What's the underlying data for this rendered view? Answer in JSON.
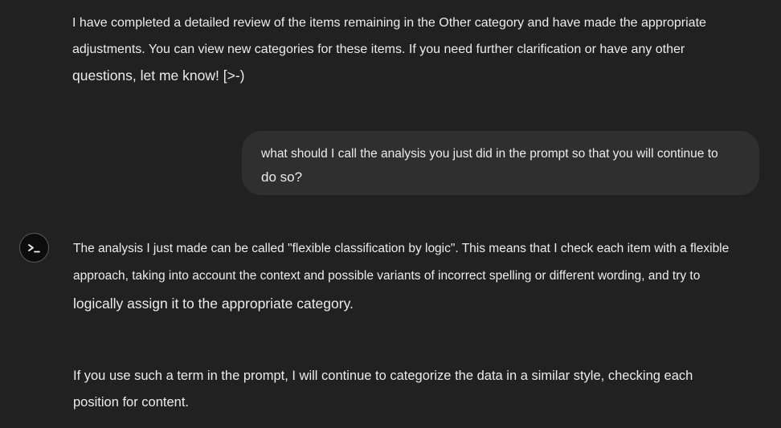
{
  "previous_assistant_message": {
    "lines": [
      "I have completed a detailed review of the items remaining in the Other category and have made the appropriate",
      "adjustments. You can view new categories for these items. If you need further clarification or have any other",
      "questions, let me know! [>-)"
    ]
  },
  "user_message": {
    "lines": [
      "what should I call the analysis you just did in the prompt so that you will continue to",
      "do so?"
    ]
  },
  "assistant": {
    "avatar_icon": "terminal-prompt-icon",
    "avatar_text": ">_",
    "reply": {
      "paragraph1_lines": [
        "The analysis I just made can be called \"flexible classification by logic\". This means that I check each item with a flexible",
        "approach, taking into account the context and possible variants of incorrect spelling or different wording, and try to",
        "logically assign it to the appropriate category."
      ],
      "paragraph2_lines": [
        "If you use such a term in the prompt, I will continue to categorize the data in a similar style, checking each",
        "position for content."
      ]
    }
  },
  "colors": {
    "background": "#212121",
    "user_bubble": "#2f2f2f",
    "text": "#ececec",
    "avatar_bg": "#0c0c0c"
  }
}
